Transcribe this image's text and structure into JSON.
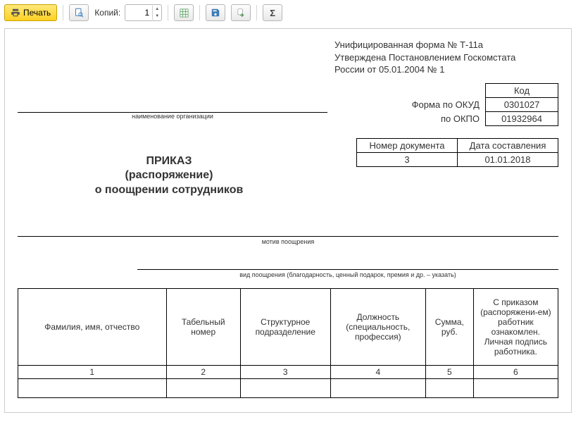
{
  "toolbar": {
    "print_label": "Печать",
    "copies_label": "Копий:",
    "copies_value": "1"
  },
  "form_header": {
    "line1": "Унифицированная форма № Т-11а",
    "line2": "Утверждена Постановлением Госкомстата",
    "line3": "России от 05.01.2004 № 1"
  },
  "codes": {
    "kod_header": "Код",
    "okud_label": "Форма по ОКУД",
    "okud_value": "0301027",
    "okpo_label": "по ОКПО",
    "okpo_value": "01932964"
  },
  "org_note": "наименование организации",
  "meta": {
    "doc_num_header": "Номер документа",
    "doc_date_header": "Дата составления",
    "doc_num": "3",
    "doc_date": "01.01.2018"
  },
  "titles": {
    "l1": "ПРИКАЗ",
    "l2": "(распоряжение)",
    "l3": "о поощрении сотрудников"
  },
  "motive_note": "мотив поощрения",
  "type_note": "вид поощрения (благодарность, ценный подарок, премия и др. – указать)",
  "table": {
    "h1": "Фамилия, имя, отчество",
    "h2": "Табельный номер",
    "h3": "Структурное подразделение",
    "h4": "Должность (специальность, профессия)",
    "h5": "Сумма, руб.",
    "h6": "С приказом (распоряжени-ем) работник ознакомлен. Личная подпись работника.",
    "n1": "1",
    "n2": "2",
    "n3": "3",
    "n4": "4",
    "n5": "5",
    "n6": "6"
  }
}
